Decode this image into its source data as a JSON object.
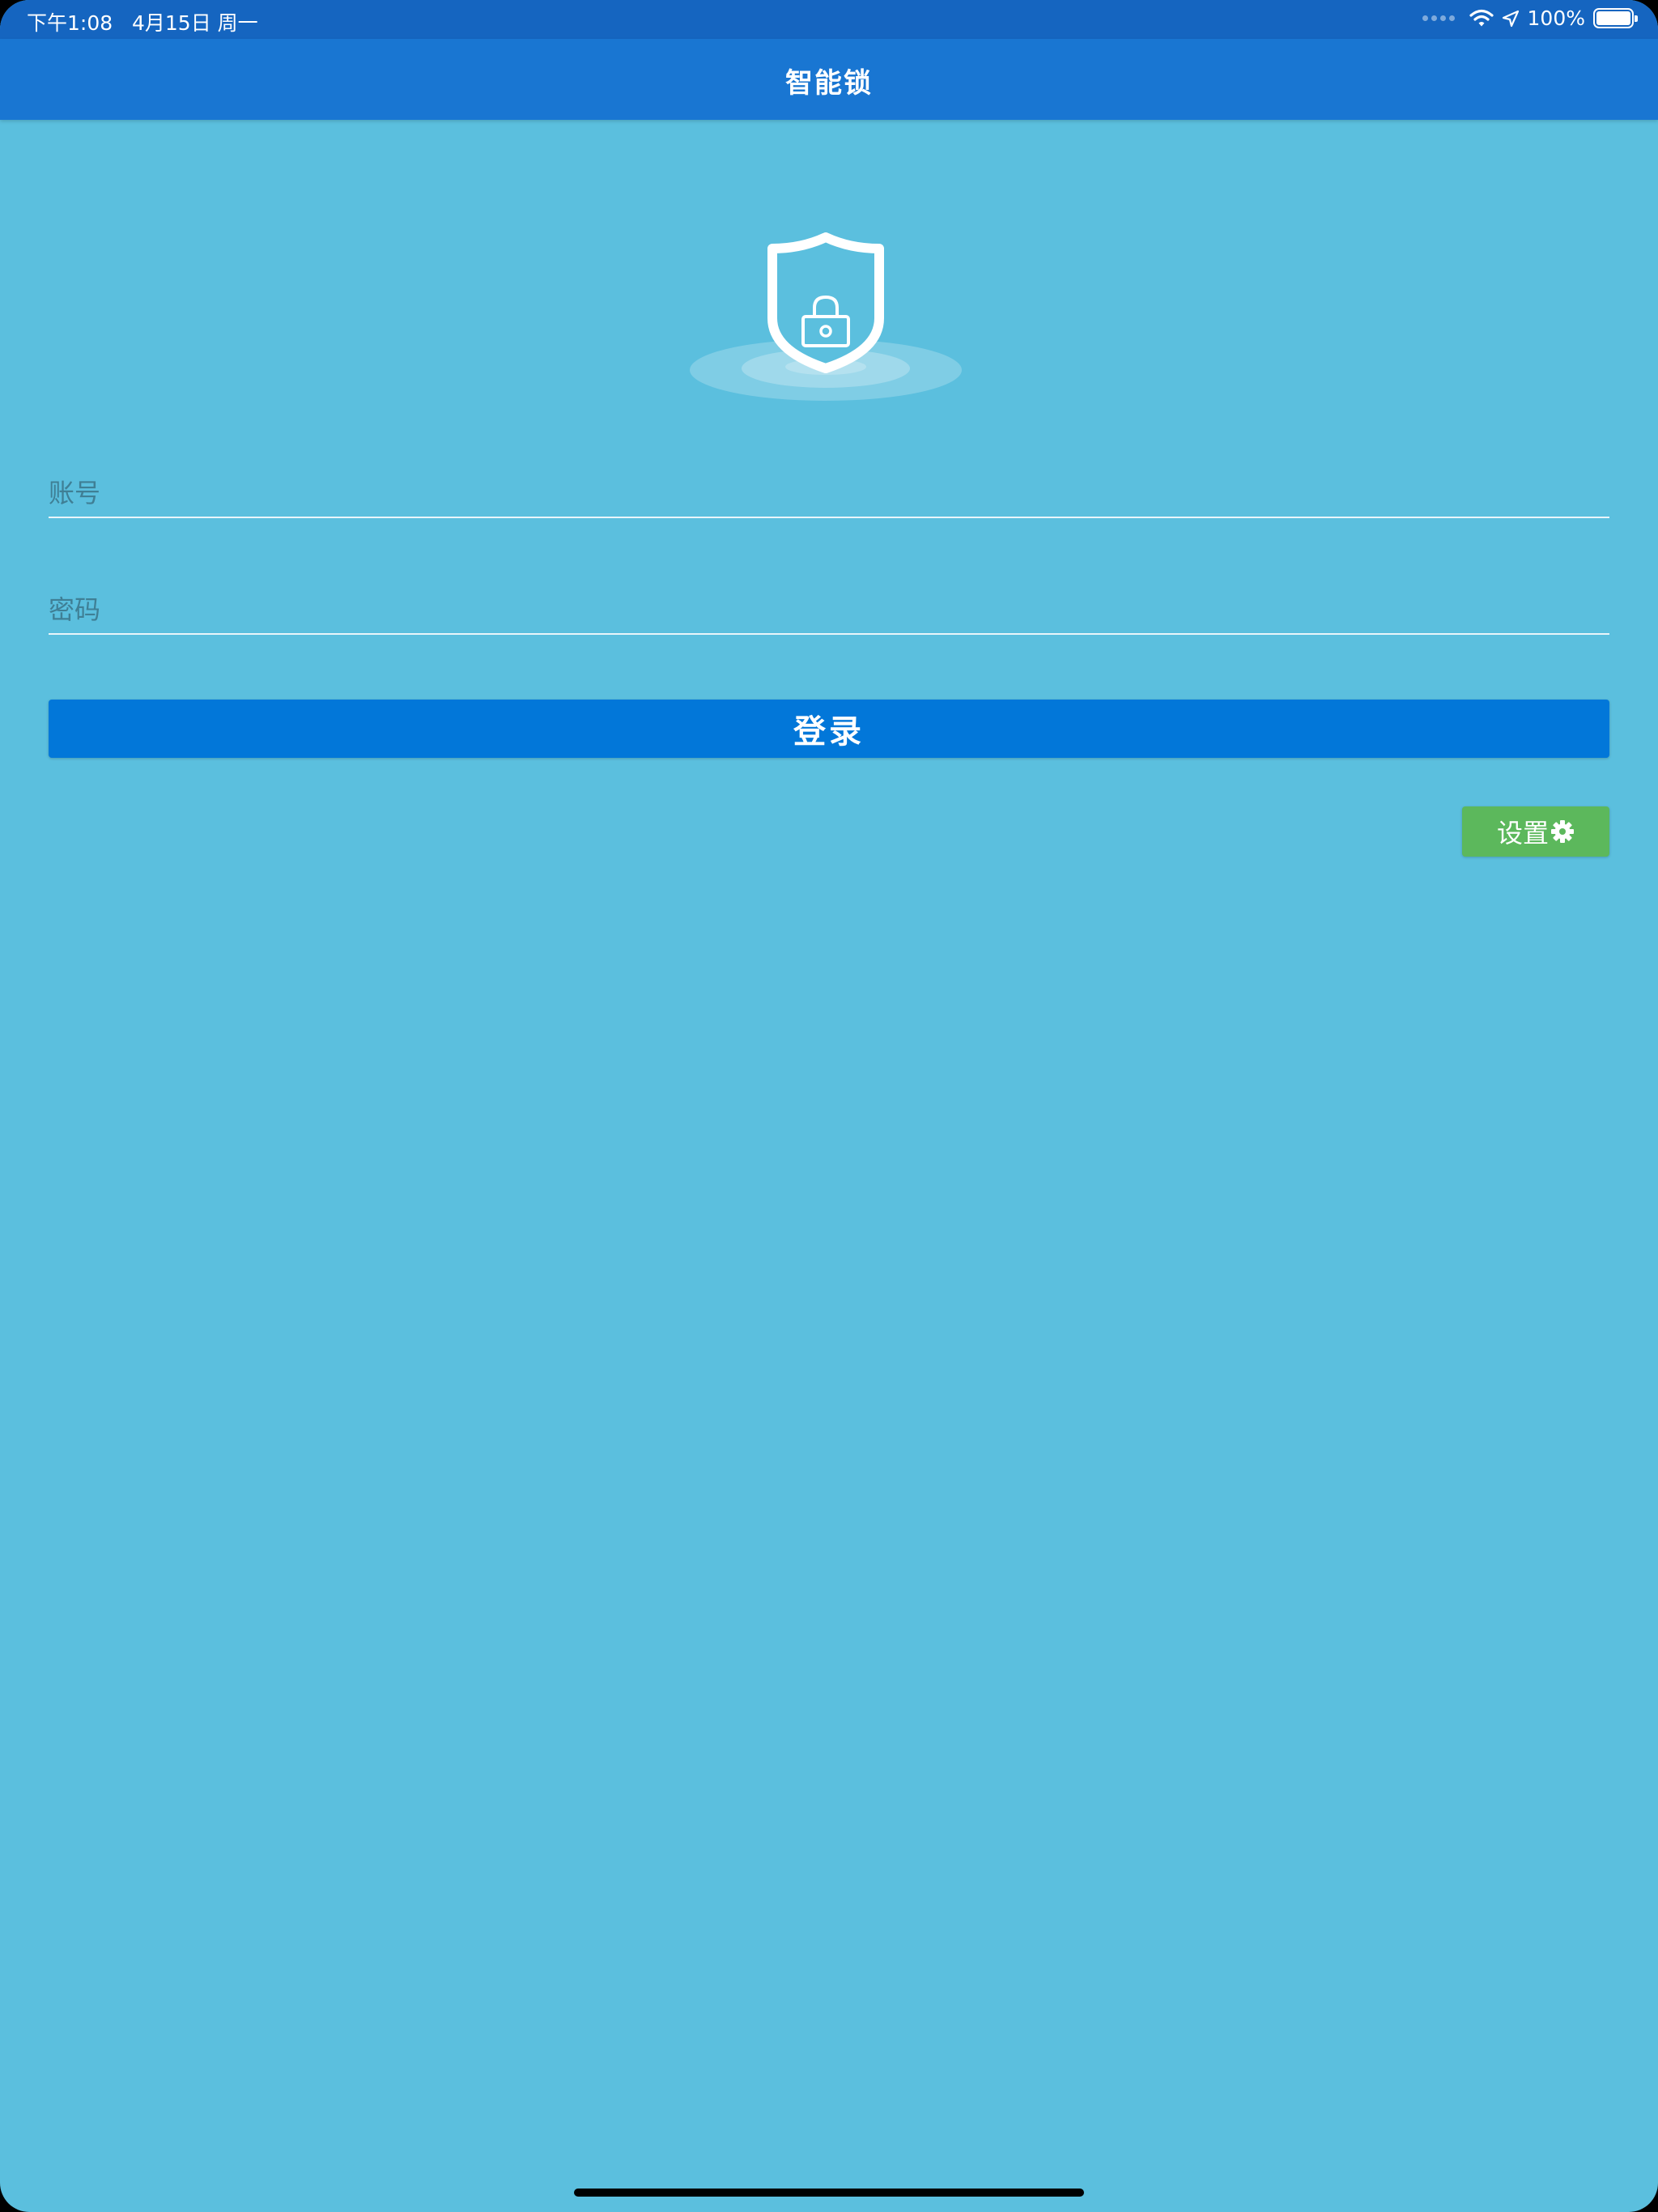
{
  "status_bar": {
    "time_date": "下午1:08   4月15日 周一",
    "battery_text": "100%",
    "battery_level": 1.0,
    "icons": [
      "signal-dots-icon",
      "wifi-icon",
      "location-arrow-icon",
      "battery-icon"
    ]
  },
  "nav": {
    "title": "智能锁"
  },
  "logo": {
    "icon": "shield-lock-icon"
  },
  "form": {
    "account_placeholder": "账号",
    "account_value": "",
    "password_placeholder": "密码",
    "password_value": ""
  },
  "actions": {
    "login_label": "登录",
    "settings_label": "设置",
    "settings_icon": "gear-icon"
  },
  "colors": {
    "background": "#5bbfde",
    "status_bar": "#1565c0",
    "nav_bar": "#1976d2",
    "login_button": "#0277d9",
    "settings_button": "#5cb85c"
  }
}
